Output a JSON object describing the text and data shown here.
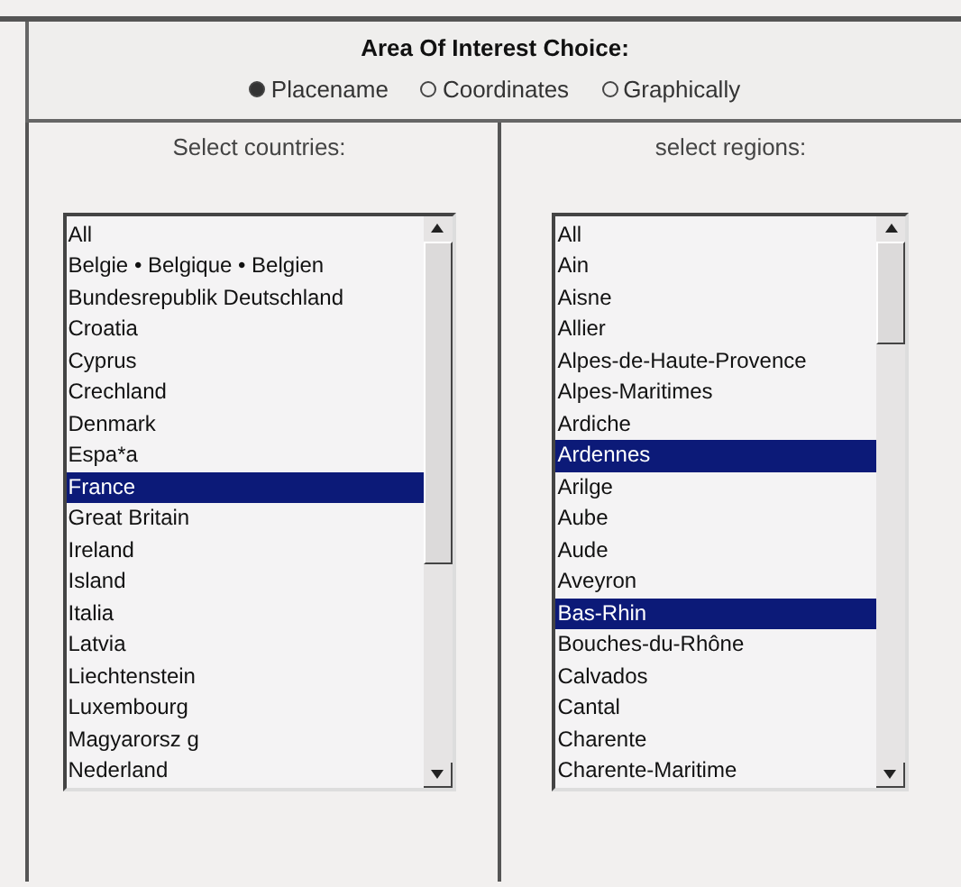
{
  "header": {
    "title": "Area Of Interest Choice:",
    "options": [
      {
        "label": "Placename",
        "selected": true
      },
      {
        "label": "Coordinates",
        "selected": false
      },
      {
        "label": "Graphically",
        "selected": false
      }
    ]
  },
  "panels": [
    {
      "heading": "Select countries:",
      "items": [
        {
          "label": "All",
          "selected": false
        },
        {
          "label": "Belgie • Belgique • Belgien",
          "selected": false
        },
        {
          "label": "Bundesrepublik Deutschland",
          "selected": false
        },
        {
          "label": "Croatia",
          "selected": false
        },
        {
          "label": "Cyprus",
          "selected": false
        },
        {
          "label": "Crechland",
          "selected": false
        },
        {
          "label": "Denmark",
          "selected": false
        },
        {
          "label": "Espa*a",
          "selected": false
        },
        {
          "label": "France",
          "selected": true
        },
        {
          "label": "Great Britain",
          "selected": false
        },
        {
          "label": "Ireland",
          "selected": false
        },
        {
          "label": "Island",
          "selected": false
        },
        {
          "label": "Italia",
          "selected": false
        },
        {
          "label": "Latvia",
          "selected": false
        },
        {
          "label": "Liechtenstein",
          "selected": false
        },
        {
          "label": "Luxembourg",
          "selected": false
        },
        {
          "label": "Magyarorsz g",
          "selected": false
        },
        {
          "label": "Nederland",
          "selected": false
        }
      ]
    },
    {
      "heading": "select regions:",
      "items": [
        {
          "label": "All",
          "selected": false
        },
        {
          "label": "Ain",
          "selected": false
        },
        {
          "label": "Aisne",
          "selected": false
        },
        {
          "label": "Allier",
          "selected": false
        },
        {
          "label": "Alpes-de-Haute-Provence",
          "selected": false
        },
        {
          "label": "Alpes-Maritimes",
          "selected": false
        },
        {
          "label": "Ardiche",
          "selected": false
        },
        {
          "label": "Ardennes",
          "selected": true
        },
        {
          "label": "Arilge",
          "selected": false
        },
        {
          "label": "Aube",
          "selected": false
        },
        {
          "label": "Aude",
          "selected": false
        },
        {
          "label": "Aveyron",
          "selected": false
        },
        {
          "label": "Bas-Rhin",
          "selected": true
        },
        {
          "label": "Bouches-du-Rhône",
          "selected": false
        },
        {
          "label": "Calvados",
          "selected": false
        },
        {
          "label": "Cantal",
          "selected": false
        },
        {
          "label": "Charente",
          "selected": false
        },
        {
          "label": "Charente-Maritime",
          "selected": false
        }
      ]
    }
  ]
}
